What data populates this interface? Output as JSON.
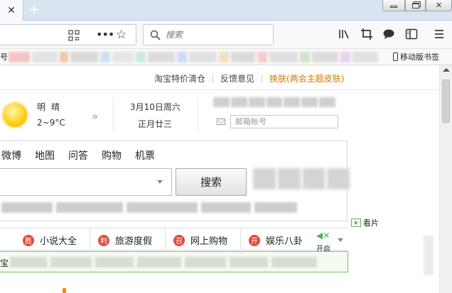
{
  "browser": {
    "tab": {
      "close_glyph": "✕"
    },
    "new_tab_glyph": "+",
    "window_buttons": [
      "minimize",
      "maximize",
      "close"
    ],
    "search_placeholder": "搜索",
    "toolbar_icons": [
      "library-icon",
      "screenshot-icon",
      "chat-icon",
      "sidebar-icon",
      "menu-icon"
    ],
    "bookmarks": {
      "first_fragment": "号",
      "mobile_label": "移动版书签"
    }
  },
  "page": {
    "top_links": [
      "淘宝特价清仓",
      "反馈意见",
      "换肤(两会主题皮肤)"
    ],
    "weather": {
      "condition": "明晴",
      "temp": "2~9°C",
      "more_glyph": "»"
    },
    "date": {
      "solar": "3月10日周六",
      "lunar": "正月廿三"
    },
    "mail_placeholder": "邮箱帐号",
    "search_tabs": [
      "微博",
      "地图",
      "问答",
      "购物",
      "机票"
    ],
    "search_button": "搜索",
    "hot_items": [
      {
        "badge": "胜",
        "label": "小说大全"
      },
      {
        "badge": "利",
        "label": "旅游度假"
      },
      {
        "badge": "召",
        "label": "网上购物"
      },
      {
        "badge": "开",
        "label": "娱乐八卦"
      }
    ],
    "sound_label": "开启",
    "green_first": "宝",
    "kanpian_label": "看片"
  },
  "colors": {
    "accent_orange": "#d67a00",
    "badge_red": "#e04a3a",
    "green_border": "#7cc36a"
  }
}
